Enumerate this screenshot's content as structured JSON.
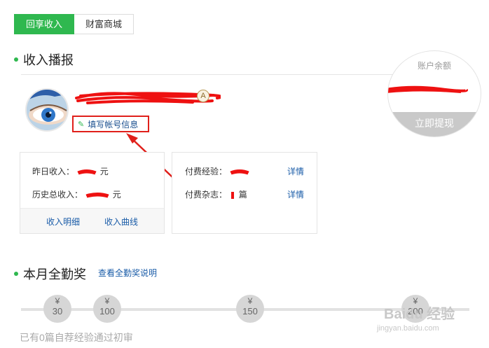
{
  "tabs": [
    {
      "label": "回享收入",
      "active": true
    },
    {
      "label": "财富商城",
      "active": false
    }
  ],
  "income_report": {
    "title": "收入播报"
  },
  "profile": {
    "edit_link": "填写帐号信息"
  },
  "income_card": {
    "yesterday_label": "昨日收入：",
    "yesterday_unit": "元",
    "total_label": "历史总收入：",
    "total_unit": "元",
    "detail_link": "收入明细",
    "curve_link": "收入曲线"
  },
  "paid_card": {
    "experience_label": "付费经验：",
    "magazine_label": "付费杂志：",
    "magazine_unit": "篇",
    "detail_label": "详情"
  },
  "balance": {
    "label": "账户余额",
    "withdraw": "立即提现"
  },
  "attendance": {
    "title": "本月全勤奖",
    "explain_link": "查看全勤奖说明",
    "milestones": [
      {
        "yen": "¥",
        "value": "30"
      },
      {
        "yen": "¥",
        "value": "100"
      },
      {
        "yen": "¥",
        "value": "150"
      },
      {
        "yen": "¥",
        "value": "200"
      }
    ],
    "status": "已有0篇自荐经验通过初审"
  },
  "watermark": {
    "brand": "Baidu 经验",
    "url": "jingyan.baidu.com"
  },
  "colors": {
    "accent": "#2fb84f",
    "link": "#1a5ca8",
    "annotation": "#e0201b"
  }
}
